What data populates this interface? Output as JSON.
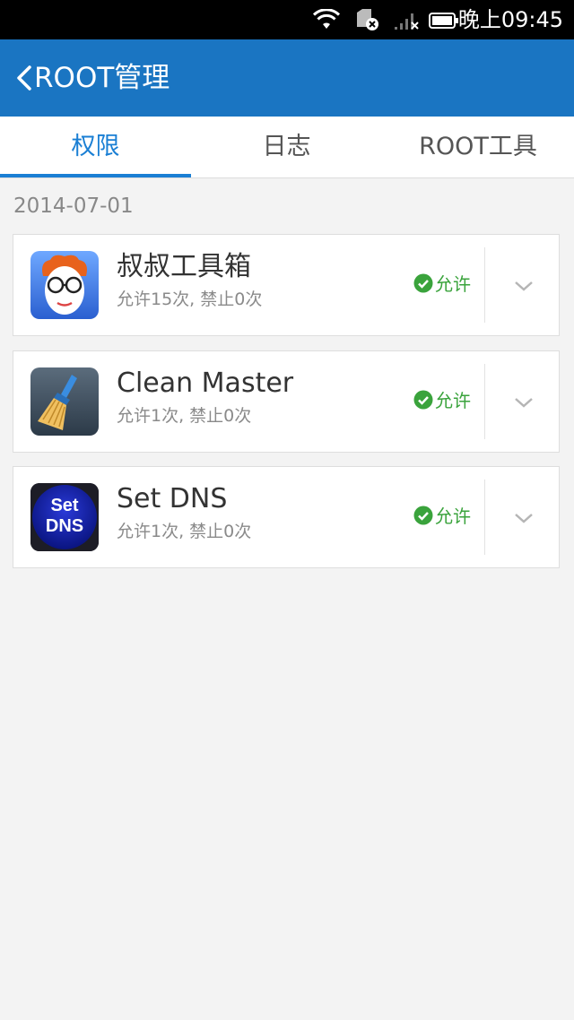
{
  "status_bar": {
    "time": "晚上09:45"
  },
  "app_bar": {
    "title": "ROOT管理"
  },
  "tabs": [
    {
      "label": "权限",
      "active": true
    },
    {
      "label": "日志",
      "active": false
    },
    {
      "label": "ROOT工具",
      "active": false
    }
  ],
  "date_header": "2014-07-01",
  "apps": [
    {
      "name": "叔叔工具箱",
      "stats": "允许15次, 禁止0次",
      "status": "允许",
      "icon": "uncle-toolbox-icon"
    },
    {
      "name": "Clean Master",
      "stats": "允许1次, 禁止0次",
      "status": "允许",
      "icon": "clean-master-broom-icon"
    },
    {
      "name": "Set DNS",
      "stats": "允许1次, 禁止0次",
      "status": "允许",
      "icon": "set-dns-icon",
      "icon_text": [
        "Set",
        "DNS"
      ]
    }
  ],
  "colors": {
    "accent": "#1a75c2",
    "tab_active": "#1a7fd4",
    "allow_green": "#3aa33c"
  }
}
